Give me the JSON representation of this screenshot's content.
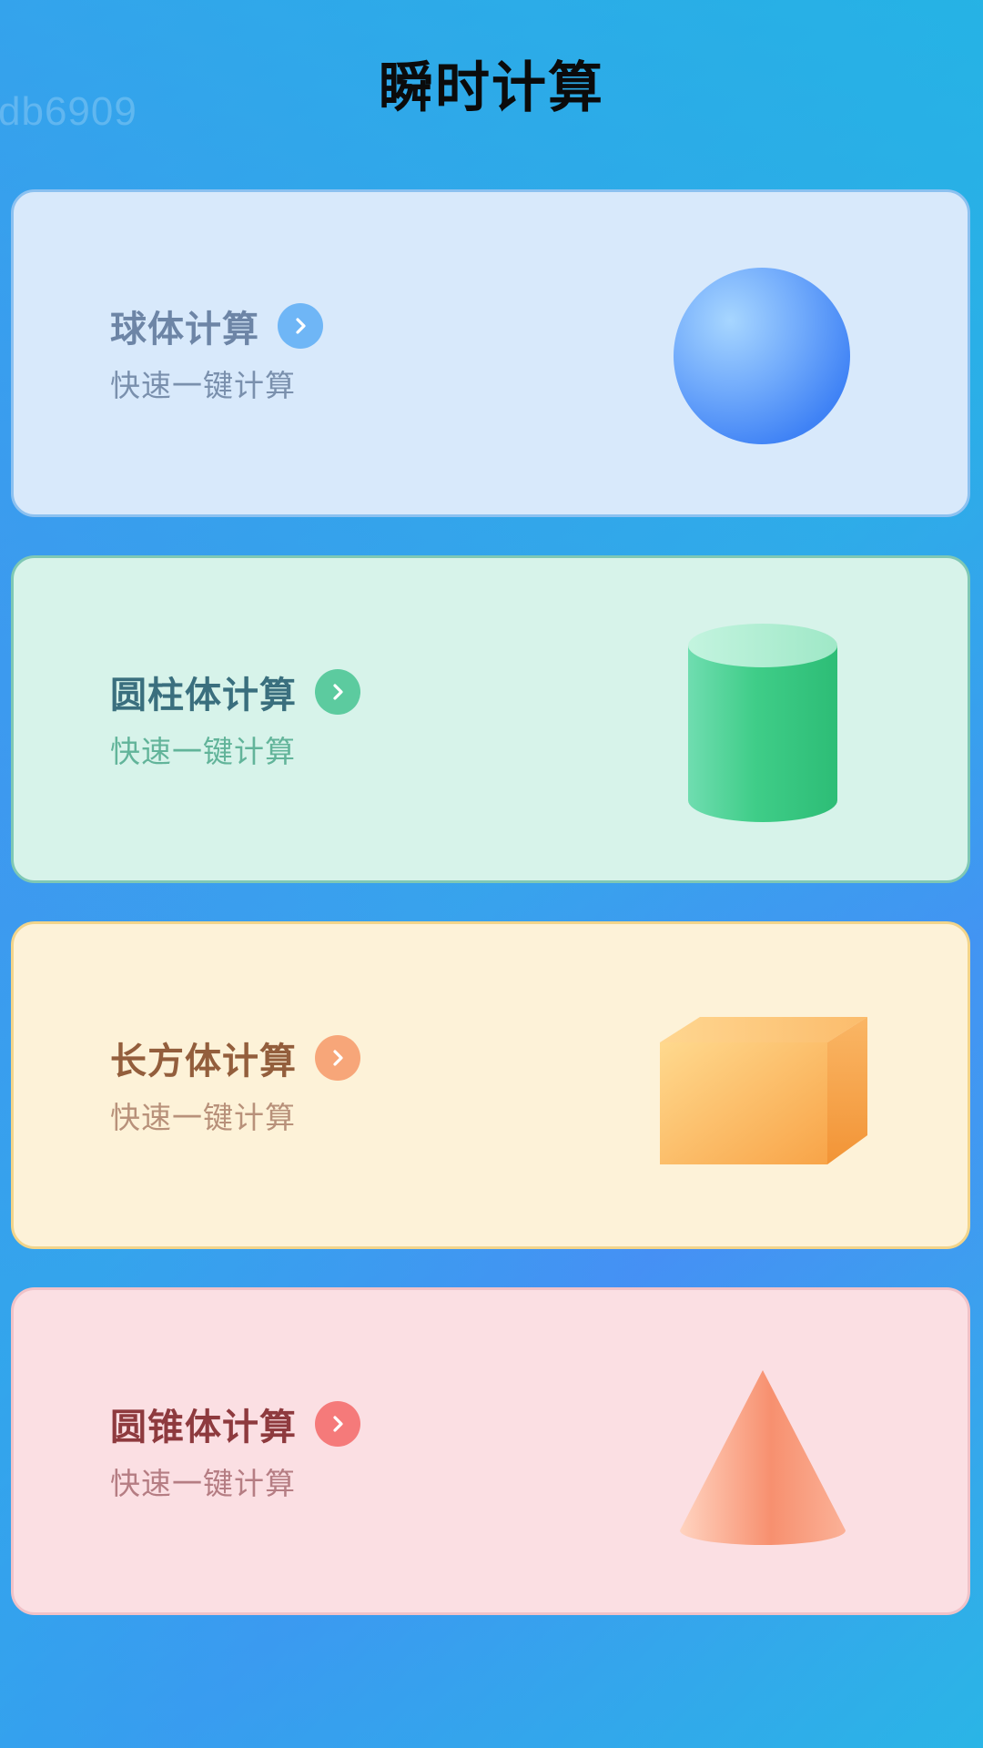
{
  "watermark": "db6909",
  "header": {
    "title": "瞬时计算"
  },
  "cards": [
    {
      "title": "球体计算",
      "subtitle": "快速一键计算",
      "shape_icon": "sphere-icon",
      "bg": "#d8e9fb",
      "border": "#8cc1f0",
      "title_color": "#6d85a6",
      "sub_color": "#7a90ad",
      "arrow_color": "#6fb6f6"
    },
    {
      "title": "圆柱体计算",
      "subtitle": "快速一键计算",
      "shape_icon": "cylinder-icon",
      "bg": "#d7f3ea",
      "border": "#7fc8b4",
      "title_color": "#3a6f7e",
      "sub_color": "#62b49a",
      "arrow_color": "#5ccb9f"
    },
    {
      "title": "长方体计算",
      "subtitle": "快速一键计算",
      "shape_icon": "cuboid-icon",
      "bg": "#fdf2d8",
      "border": "#f2d48a",
      "title_color": "#935e3c",
      "sub_color": "#b8917a",
      "arrow_color": "#f7a679"
    },
    {
      "title": "圆锥体计算",
      "subtitle": "快速一键计算",
      "shape_icon": "cone-icon",
      "bg": "#fbdfe3",
      "border": "#f0c2c8",
      "title_color": "#8e3a3e",
      "sub_color": "#b57d83",
      "arrow_color": "#f57a7a"
    }
  ]
}
